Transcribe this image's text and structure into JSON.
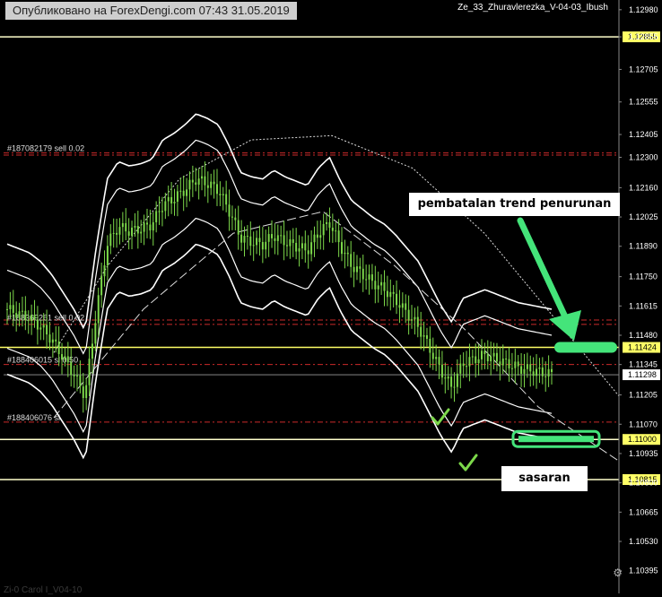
{
  "watermark": "Опубликовано на ForexDengi.com 07:43 31.05.2019",
  "indicator_name": "Ze_33_Zhuravlerezka_V-04-03_Ibush",
  "annotations": {
    "top": "pembatalan trend penurunan",
    "bottom": "sasaran"
  },
  "order_labels": [
    "#187082179 sell 0.02",
    "#188369261 sell 0.02",
    "#188406015 sl 0.50",
    "#188406076 sl"
  ],
  "bottom_left_text": "Zi-0 Carol I_V04-10",
  "colors": {
    "background": "#000000",
    "candles": "#7cd84a",
    "bands": "#ffffff",
    "level_yellow": "#ffff66",
    "arrow": "#44e47a",
    "checkmark": "#7cd84a",
    "stop_red": "#cc2a2a"
  },
  "chart_data": {
    "type": "candlestick",
    "y_axis": {
      "range": [
        1.1034,
        1.13
      ],
      "ticks": [
        "1.12980",
        "1.12855",
        "1.12705",
        "1.12555",
        "1.12405",
        "1.12300",
        "1.12160",
        "1.12025",
        "1.11890",
        "1.11750",
        "1.11615",
        "1.11480",
        "1.11345",
        "1.11205",
        "1.11070",
        "1.10935",
        "1.10800",
        "1.10665",
        "1.10530",
        "1.10395"
      ]
    },
    "highlighted_levels": [
      {
        "label": "1.12855",
        "value": 1.12855
      },
      {
        "label": "1.11424",
        "value": 1.11424
      },
      {
        "label": "1.11000",
        "value": 1.11
      },
      {
        "label": "1.10815",
        "value": 1.10815
      }
    ],
    "current_price": {
      "label": "1.11298",
      "value": 1.11298
    },
    "order_levels": [
      1.1232,
      1.1231,
      1.1155,
      1.1153,
      1.11345,
      1.1108
    ],
    "close_path": [
      1.116,
      1.1158,
      1.1156,
      1.1152,
      1.1146,
      1.1138,
      1.113,
      1.112,
      1.1158,
      1.119,
      1.1198,
      1.1196,
      1.1197,
      1.1199,
      1.1208,
      1.1211,
      1.1215,
      1.122,
      1.1218,
      1.1215,
      1.1205,
      1.1193,
      1.1191,
      1.119,
      1.1194,
      1.1191,
      1.1189,
      1.1187,
      1.1195,
      1.12,
      1.1189,
      1.118,
      1.1176,
      1.1172,
      1.1169,
      1.1164,
      1.1158,
      1.1152,
      1.1142,
      1.1132,
      1.1124,
      1.1135,
      1.1137,
      1.1139,
      1.1137,
      1.1135,
      1.1133,
      1.1132,
      1.1131,
      1.113
    ]
  }
}
